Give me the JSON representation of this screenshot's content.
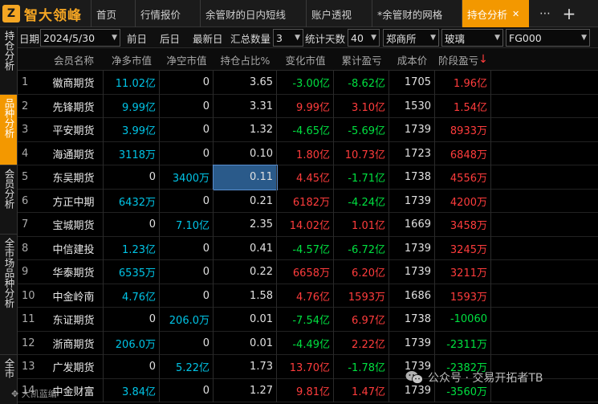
{
  "app": {
    "logo_mark": "Z",
    "logo_text": "智大领峰"
  },
  "tabs": [
    {
      "label": "首页"
    },
    {
      "label": "行情报价"
    },
    {
      "label": "余管财的日内短线"
    },
    {
      "label": "账户透视"
    },
    {
      "label": "*余管财的网格"
    },
    {
      "label": "持仓分析",
      "active": true
    }
  ],
  "sidebar": [
    {
      "label": "持仓分析"
    },
    {
      "label": "品种分析",
      "active": true
    },
    {
      "label": "会员分析"
    },
    {
      "label": "全市场品种分析"
    },
    {
      "label": "全市"
    }
  ],
  "filter": {
    "date_label": "日期",
    "date_value": "2024/5/30",
    "prev_day": "前日",
    "next_day": "后日",
    "latest_day": "最新日",
    "count_label": "汇总数量",
    "count_value": "3",
    "days_label": "统计天数",
    "days_value": "40",
    "exchange": "郑商所",
    "product": "玻璃",
    "contract": "FG000"
  },
  "columns": [
    "会员名称",
    "净多市值",
    "净空市值",
    "持仓占比%",
    "变化市值",
    "累计盈亏",
    "成本价",
    "阶段盈亏"
  ],
  "sort_arrow": "↓",
  "rows": [
    {
      "idx": "1",
      "name": "徽商期货",
      "long": "11.02亿",
      "short": "0",
      "ratio": "3.65",
      "change": "-3.00亿",
      "cum": "-8.62亿",
      "cost": "1705",
      "stage": "1.96亿"
    },
    {
      "idx": "2",
      "name": "先锋期货",
      "long": "9.99亿",
      "short": "0",
      "ratio": "3.31",
      "change": "9.99亿",
      "cum": "3.10亿",
      "cost": "1530",
      "stage": "1.54亿"
    },
    {
      "idx": "3",
      "name": "平安期货",
      "long": "3.99亿",
      "short": "0",
      "ratio": "1.32",
      "change": "-4.65亿",
      "cum": "-5.69亿",
      "cost": "1739",
      "stage": "8933万"
    },
    {
      "idx": "4",
      "name": "海通期货",
      "long": "3118万",
      "short": "0",
      "ratio": "0.10",
      "change": "1.80亿",
      "cum": "10.73亿",
      "cost": "1723",
      "stage": "6848万"
    },
    {
      "idx": "5",
      "name": "东吴期货",
      "long": "0",
      "short": "3400万",
      "ratio": "0.11",
      "change": "4.45亿",
      "cum": "-1.71亿",
      "cost": "1738",
      "stage": "4556万"
    },
    {
      "idx": "6",
      "name": "方正中期",
      "long": "6432万",
      "short": "0",
      "ratio": "0.21",
      "change": "6182万",
      "cum": "-4.24亿",
      "cost": "1739",
      "stage": "4200万"
    },
    {
      "idx": "7",
      "name": "宝城期货",
      "long": "0",
      "short": "7.10亿",
      "ratio": "2.35",
      "change": "14.02亿",
      "cum": "1.01亿",
      "cost": "1669",
      "stage": "3458万"
    },
    {
      "idx": "8",
      "name": "中信建投",
      "long": "1.23亿",
      "short": "0",
      "ratio": "0.41",
      "change": "-4.57亿",
      "cum": "-6.72亿",
      "cost": "1739",
      "stage": "3245万"
    },
    {
      "idx": "9",
      "name": "华泰期货",
      "long": "6535万",
      "short": "0",
      "ratio": "0.22",
      "change": "6658万",
      "cum": "6.20亿",
      "cost": "1739",
      "stage": "3211万"
    },
    {
      "idx": "10",
      "name": "中金岭南",
      "long": "4.76亿",
      "short": "0",
      "ratio": "1.58",
      "change": "4.76亿",
      "cum": "1593万",
      "cost": "1686",
      "stage": "1593万"
    },
    {
      "idx": "11",
      "name": "东证期货",
      "long": "0",
      "short": "206.0万",
      "ratio": "0.01",
      "change": "-7.54亿",
      "cum": "6.97亿",
      "cost": "1738",
      "stage": "-10060"
    },
    {
      "idx": "12",
      "name": "浙商期货",
      "long": "206.0万",
      "short": "0",
      "ratio": "0.01",
      "change": "-4.49亿",
      "cum": "2.22亿",
      "cost": "1739",
      "stage": "-2311万"
    },
    {
      "idx": "13",
      "name": "广发期货",
      "long": "0",
      "short": "5.22亿",
      "ratio": "1.73",
      "change": "13.70亿",
      "cum": "-1.78亿",
      "cost": "1739",
      "stage": "-2382万"
    },
    {
      "idx": "14",
      "name": "中金财富",
      "long": "3.84亿",
      "short": "0",
      "ratio": "1.27",
      "change": "9.81亿",
      "cum": "1.47亿",
      "cost": "1739",
      "stage": "-3560万"
    }
  ],
  "watermark": {
    "text": "公众号 · 交易开拓者TB",
    "small": "大凯蓝编"
  },
  "colors": {
    "accent": "#f39800",
    "up": "#ff3c3c",
    "down": "#00e040",
    "value": "#00c4e6",
    "selected": "#2a5a8a"
  }
}
